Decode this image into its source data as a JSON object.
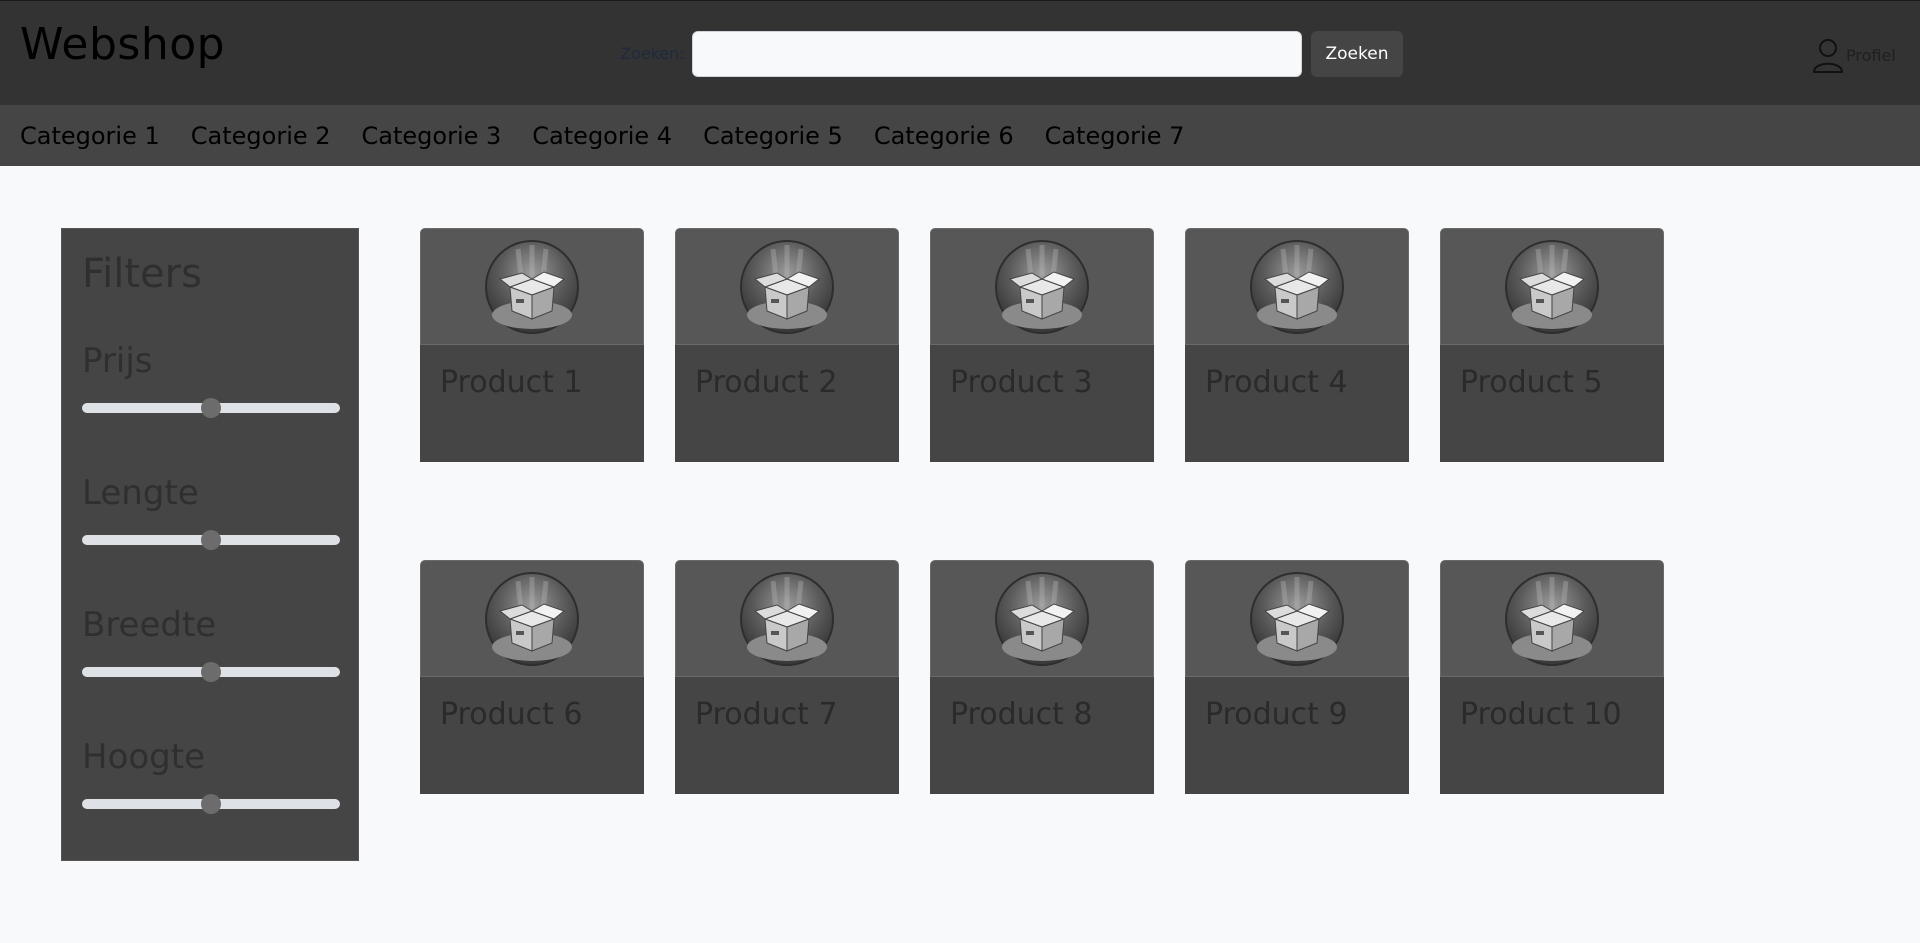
{
  "header": {
    "brand": "Webshop",
    "search_label": "Zoeken:",
    "search_value": "",
    "search_button": "Zoeken",
    "profile_label": "Profiel"
  },
  "categories": [
    "Categorie 1",
    "Categorie 2",
    "Categorie 3",
    "Categorie 4",
    "Categorie 5",
    "Categorie 6",
    "Categorie 7"
  ],
  "filters": {
    "title": "Filters",
    "items": [
      {
        "label": "Prijs",
        "value_fraction": 0.5
      },
      {
        "label": "Lengte",
        "value_fraction": 0.5
      },
      {
        "label": "Breedte",
        "value_fraction": 0.5
      },
      {
        "label": "Hoogte",
        "value_fraction": 0.5
      }
    ]
  },
  "products": [
    {
      "name": "Product 1",
      "icon": "box-icon"
    },
    {
      "name": "Product 2",
      "icon": "box-icon"
    },
    {
      "name": "Product 3",
      "icon": "box-icon"
    },
    {
      "name": "Product 4",
      "icon": "box-icon"
    },
    {
      "name": "Product 5",
      "icon": "box-icon"
    },
    {
      "name": "Product 6",
      "icon": "box-icon"
    },
    {
      "name": "Product 7",
      "icon": "box-icon"
    },
    {
      "name": "Product 8",
      "icon": "box-icon"
    },
    {
      "name": "Product 9",
      "icon": "box-icon"
    },
    {
      "name": "Product 10",
      "icon": "box-icon"
    }
  ]
}
